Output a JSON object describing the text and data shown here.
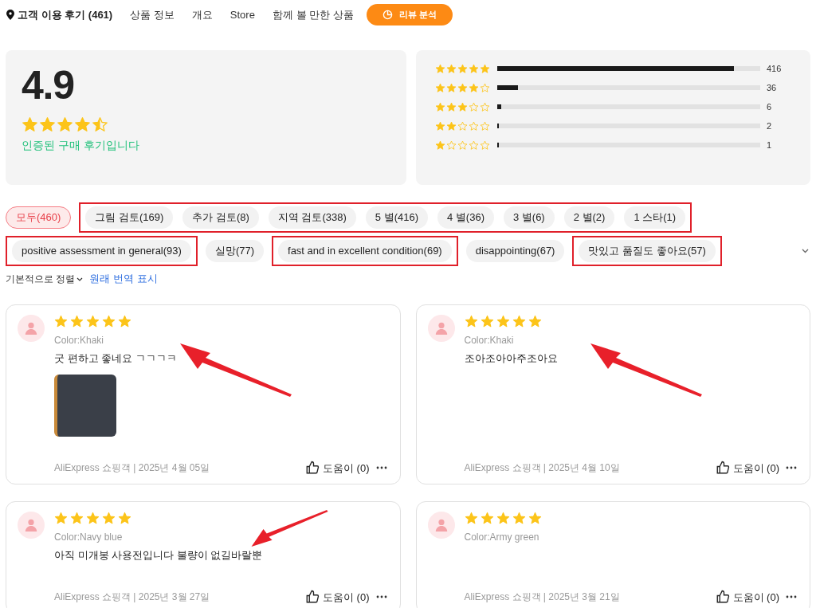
{
  "nav": {
    "title": "고객 이용 후기 (461)",
    "links": [
      "상품 정보",
      "개요",
      "Store",
      "함께 볼 만한 상품"
    ],
    "analysis_button": "리뷰 분석"
  },
  "summary": {
    "score": "4.9",
    "stars": 4.5,
    "verified": "인증된 구매 후기입니다"
  },
  "distribution": [
    {
      "stars": 5,
      "level": 0.9,
      "count": "416"
    },
    {
      "stars": 4,
      "level": 0.08,
      "count": "36"
    },
    {
      "stars": 3,
      "level": 0.015,
      "count": "6"
    },
    {
      "stars": 2,
      "level": 0.006,
      "count": "2"
    },
    {
      "stars": 1,
      "level": 0.003,
      "count": "1"
    }
  ],
  "filter_rows": [
    [
      {
        "boxed": false,
        "chips": [
          {
            "label": "모두(460)",
            "selected": true
          }
        ]
      },
      {
        "boxed": true,
        "chips": [
          {
            "label": "그림 검토(169)",
            "selected": false
          },
          {
            "label": "추가 검토(8)",
            "selected": false
          },
          {
            "label": "지역 검토(338)",
            "selected": false
          },
          {
            "label": "5 별(416)",
            "selected": false
          },
          {
            "label": "4 별(36)",
            "selected": false
          },
          {
            "label": "3 별(6)",
            "selected": false
          },
          {
            "label": "2 별(2)",
            "selected": false
          },
          {
            "label": "1 스타(1)",
            "selected": false
          }
        ]
      }
    ],
    [
      {
        "boxed": true,
        "chips": [
          {
            "label": "positive assessment in general(93)",
            "selected": false
          }
        ]
      },
      {
        "boxed": false,
        "chips": [
          {
            "label": "실망(77)",
            "selected": false
          }
        ]
      },
      {
        "boxed": true,
        "chips": [
          {
            "label": "fast and in excellent condition(69)",
            "selected": false
          }
        ]
      },
      {
        "boxed": false,
        "chips": [
          {
            "label": "disappointing(67)",
            "selected": false
          }
        ]
      },
      {
        "boxed": true,
        "chips": [
          {
            "label": "맛있고 품질도 좋아요(57)",
            "selected": false
          }
        ]
      }
    ]
  ],
  "sort": {
    "label": "기본적으로 정렬",
    "translate_link": "원래 번역 표시"
  },
  "reviews": [
    {
      "stars": 5,
      "variant": "Color:Khaki",
      "text": "굿 편하고 좋네요 ㄱㄱㄱㅋ",
      "has_photo": true,
      "arrow": true,
      "footer": "AliExpress 쇼핑객 | 2025년 4월 05일",
      "helpful": "도움이 (0)"
    },
    {
      "stars": 5,
      "variant": "Color:Khaki",
      "text": "조아조아아주조아요",
      "has_photo": false,
      "arrow": true,
      "footer": "AliExpress 쇼핑객 | 2025년 4월 10일",
      "helpful": "도움이 (0)"
    },
    {
      "stars": 5,
      "variant": "Color:Navy blue",
      "text": "아직 미개봉 사용전입니다 불량이 없길바랄뿐",
      "has_photo": false,
      "arrow": true,
      "footer": "AliExpress 쇼핑객 | 2025년 3월 27일",
      "helpful": "도움이 (0)"
    },
    {
      "stars": 5,
      "variant": "Color:Army green",
      "has_photo": false,
      "arrow": false,
      "footer": "AliExpress 쇼핑객 | 2025년 3월 21일",
      "helpful": "도움이 (0)"
    }
  ]
}
